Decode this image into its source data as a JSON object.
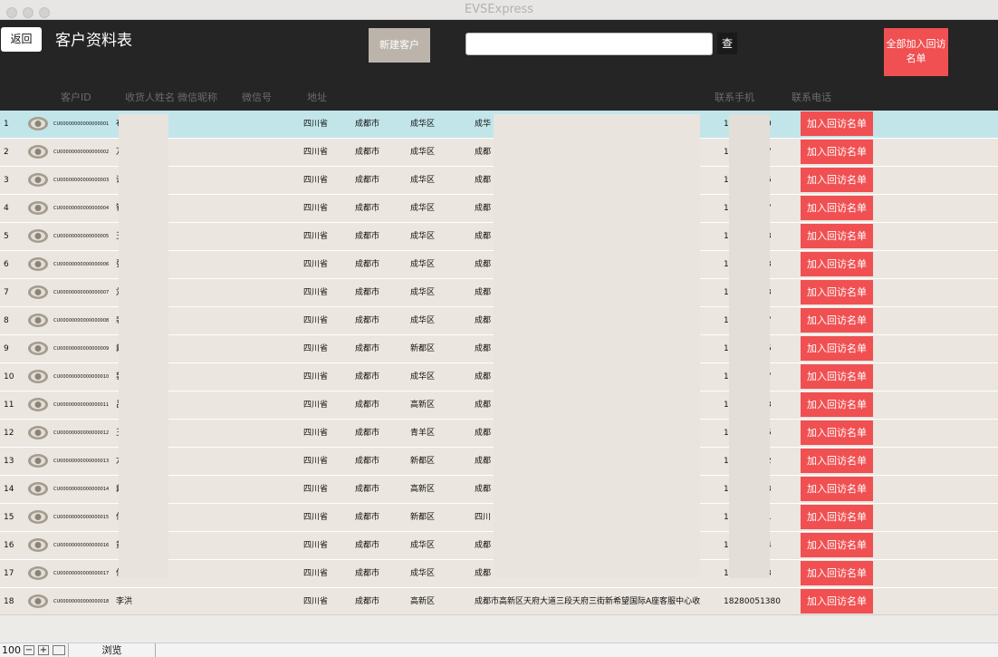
{
  "window": {
    "title": "EVSExpress"
  },
  "header": {
    "back_label": "返回",
    "title": "客户资料表",
    "new_customer_label": "新建客户",
    "search_placeholder": "",
    "search_button_label": "查",
    "add_all_label": "全部加入回访名单"
  },
  "columns": [
    "客户ID",
    "收货人姓名",
    "微信昵称",
    "微信号",
    "地址",
    "联系手机",
    "联系电话"
  ],
  "row_button_label": "加入回访名单",
  "rows": [
    {
      "idx": "1",
      "id": "CU00000000000000001",
      "name": "布",
      "province": "四川省",
      "city": "成都市",
      "district": "成华区",
      "address": "成华",
      "phone": "1",
      "phone_tail": "0"
    },
    {
      "idx": "2",
      "id": "CU00000000000000002",
      "name": "万",
      "province": "四川省",
      "city": "成都市",
      "district": "成华区",
      "address": "成都",
      "phone": "1",
      "phone_tail": "7"
    },
    {
      "idx": "3",
      "id": "CU00000000000000003",
      "name": "谭",
      "province": "四川省",
      "city": "成都市",
      "district": "成华区",
      "address": "成都",
      "phone": "1",
      "phone_tail": "5"
    },
    {
      "idx": "4",
      "id": "CU00000000000000004",
      "name": "钟",
      "province": "四川省",
      "city": "成都市",
      "district": "成华区",
      "address": "成都",
      "phone": "1",
      "phone_tail": "7"
    },
    {
      "idx": "5",
      "id": "CU00000000000000005",
      "name": "王",
      "province": "四川省",
      "city": "成都市",
      "district": "成华区",
      "address": "成都",
      "phone": "1",
      "phone_tail": "3"
    },
    {
      "idx": "6",
      "id": "CU00000000000000006",
      "name": "张",
      "province": "四川省",
      "city": "成都市",
      "district": "成华区",
      "address": "成都",
      "phone": "1",
      "phone_tail": "3"
    },
    {
      "idx": "7",
      "id": "CU00000000000000007",
      "name": "刘",
      "province": "四川省",
      "city": "成都市",
      "district": "成华区",
      "address": "成都",
      "phone": "1",
      "phone_tail": "3"
    },
    {
      "idx": "8",
      "id": "CU00000000000000008",
      "name": "裴",
      "province": "四川省",
      "city": "成都市",
      "district": "成华区",
      "address": "成都",
      "phone": "1",
      "phone_tail": "7"
    },
    {
      "idx": "9",
      "id": "CU00000000000000009",
      "name": "戴",
      "province": "四川省",
      "city": "成都市",
      "district": "新都区",
      "address": "成都",
      "phone": "1",
      "phone_tail": "5"
    },
    {
      "idx": "10",
      "id": "CU00000000000000010",
      "name": "郭",
      "province": "四川省",
      "city": "成都市",
      "district": "成华区",
      "address": "成都",
      "phone": "1",
      "phone_tail": "7"
    },
    {
      "idx": "11",
      "id": "CU00000000000000011",
      "name": "吕",
      "province": "四川省",
      "city": "成都市",
      "district": "高新区",
      "address": "成都",
      "phone": "1",
      "phone_tail": "3"
    },
    {
      "idx": "12",
      "id": "CU00000000000000012",
      "name": "王",
      "province": "四川省",
      "city": "成都市",
      "district": "青羊区",
      "address": "成都",
      "phone": "1",
      "phone_tail": "5"
    },
    {
      "idx": "13",
      "id": "CU00000000000000013",
      "name": "龙",
      "province": "四川省",
      "city": "成都市",
      "district": "新都区",
      "address": "成都",
      "phone": "1",
      "phone_tail": "2"
    },
    {
      "idx": "14",
      "id": "CU00000000000000014",
      "name": "戴",
      "province": "四川省",
      "city": "成都市",
      "district": "高新区",
      "address": "成都",
      "phone": "1",
      "phone_tail": "3"
    },
    {
      "idx": "15",
      "id": "CU00000000000000015",
      "name": "何",
      "province": "四川省",
      "city": "成都市",
      "district": "新都区",
      "address": "四川",
      "phone": "1",
      "phone_tail": "1"
    },
    {
      "idx": "16",
      "id": "CU00000000000000016",
      "name": "黄",
      "province": "四川省",
      "city": "成都市",
      "district": "成华区",
      "address": "成都",
      "phone": "1",
      "phone_tail": "4"
    },
    {
      "idx": "17",
      "id": "CU00000000000000017",
      "name": "何",
      "province": "四川省",
      "city": "成都市",
      "district": "成华区",
      "address": "成都",
      "phone": "1",
      "phone_tail": "3"
    },
    {
      "idx": "18",
      "id": "CU00000000000000018",
      "name": "李洪",
      "province": "四川省",
      "city": "成都市",
      "district": "高新区",
      "address": "成都市高新区天府大道三段天府三街新希望国际A座客服中心收",
      "phone": "18280051380",
      "phone_tail": ""
    }
  ],
  "status": {
    "zoom": "100",
    "mode": "浏览"
  },
  "colors": {
    "header_bg": "#252525",
    "accent_red": "#f05052",
    "selected_row": "#c2e5ea",
    "row_bg": "#ebe6df"
  }
}
